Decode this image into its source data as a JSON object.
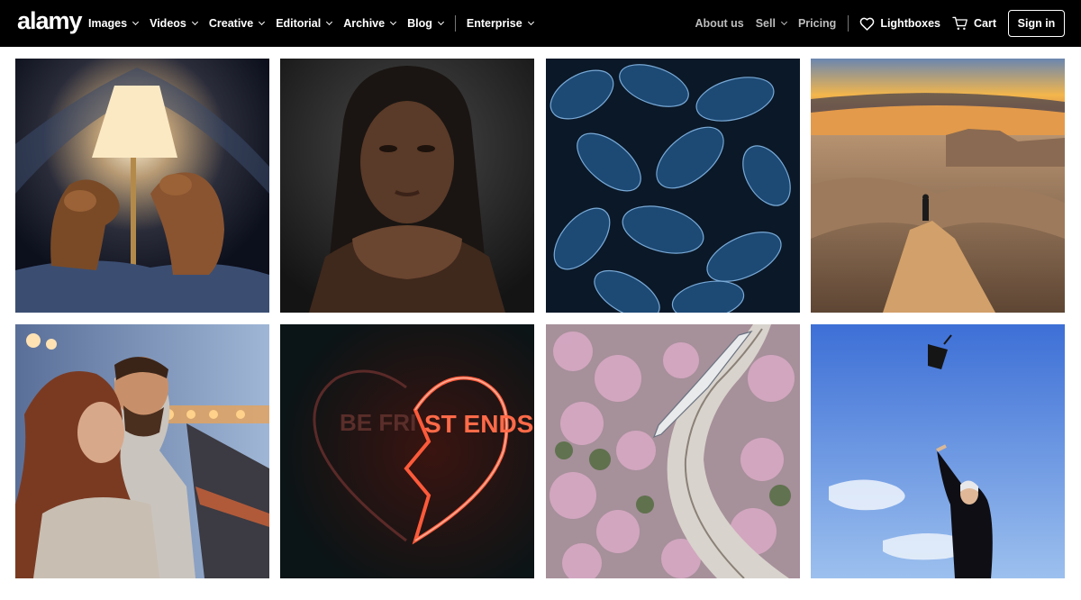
{
  "brand": {
    "logo_text": "alamy"
  },
  "nav": {
    "left": [
      {
        "label": "Images"
      },
      {
        "label": "Videos"
      },
      {
        "label": "Creative"
      },
      {
        "label": "Editorial"
      },
      {
        "label": "Archive"
      },
      {
        "label": "Blog"
      }
    ],
    "enterprise": "Enterprise",
    "right": {
      "about": "About us",
      "sell": "Sell",
      "pricing": "Pricing",
      "lightboxes": "Lightboxes",
      "cart": "Cart",
      "signin": "Sign in"
    }
  },
  "colors": {
    "topbar": "#000000",
    "page": "#ffffff",
    "muted_nav": "#bdbdbd"
  },
  "gallery": {
    "images": [
      {
        "name": "dogs-under-lamp-photo"
      },
      {
        "name": "woman-portrait-photo"
      },
      {
        "name": "frosted-leaves-photo"
      },
      {
        "name": "desert-canyon-sunset-photo"
      },
      {
        "name": "couple-at-dusk-photo"
      },
      {
        "name": "neon-best-friends-heart-photo",
        "neon_left": "BE FRI",
        "neon_right": "ST ENDS"
      },
      {
        "name": "train-through-blossoms-photo"
      },
      {
        "name": "graduate-throwing-cap-photo"
      }
    ]
  }
}
